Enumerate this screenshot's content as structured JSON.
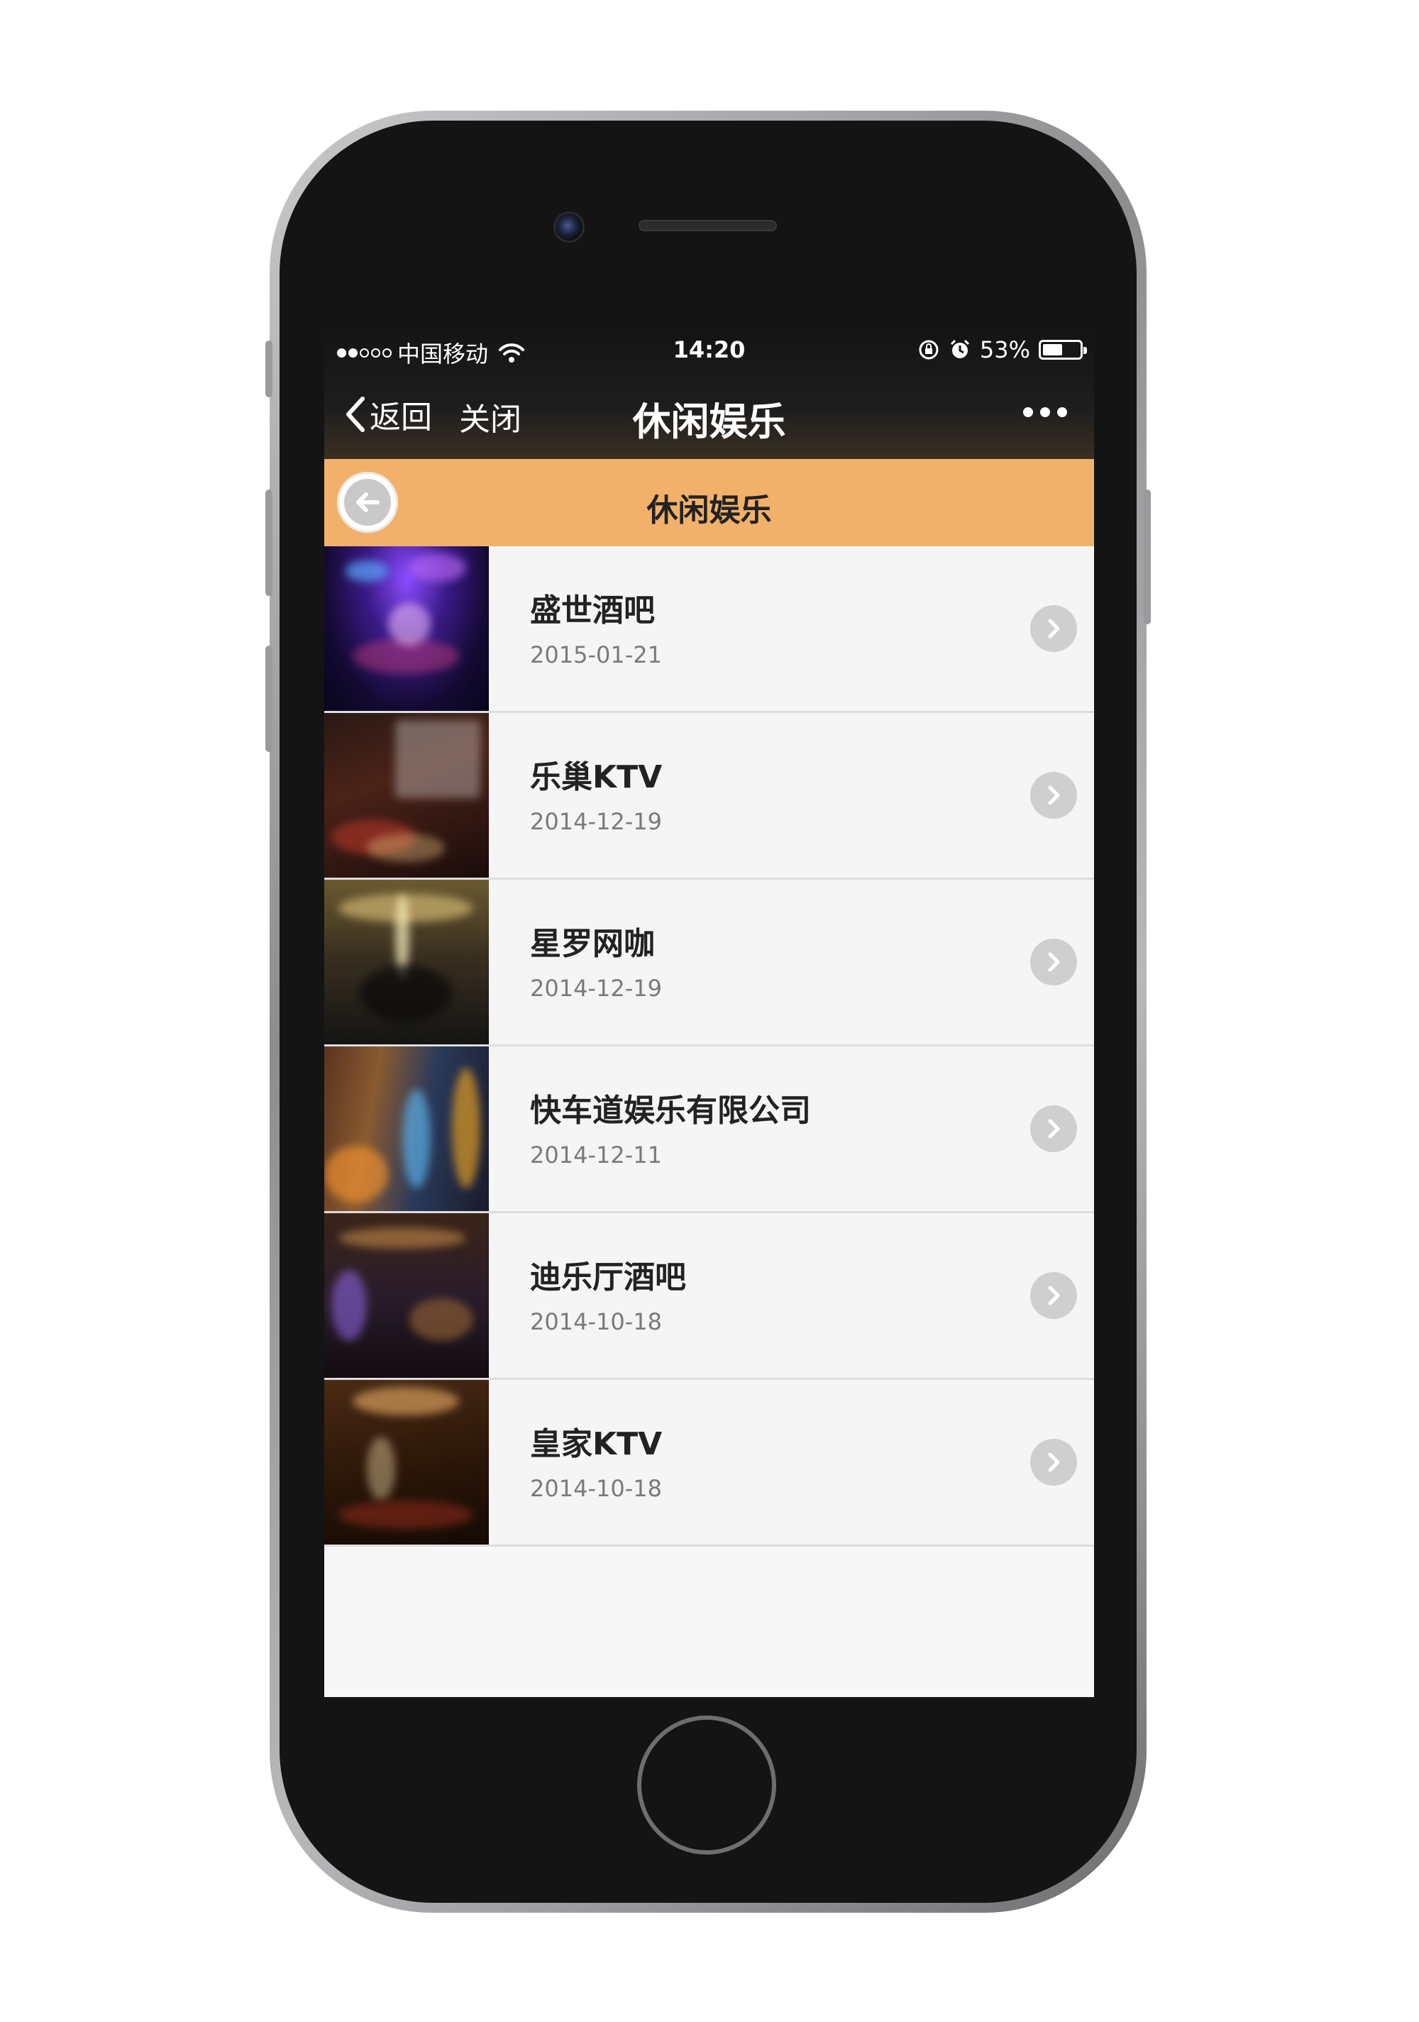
{
  "status_bar": {
    "carrier": "中国移动",
    "time": "14:20",
    "battery_percent": "53%",
    "battery_level": 0.53,
    "icons": [
      "signal-dots",
      "wifi-icon",
      "orientation-lock-icon",
      "alarm-icon",
      "battery-icon"
    ]
  },
  "nav": {
    "back_label": "返回",
    "close_label": "关闭",
    "title": "休闲娱乐",
    "more_icon": "more-dots-icon"
  },
  "page": {
    "title": "休闲娱乐",
    "back_icon": "back-arrow-circle-icon",
    "header_color": "#f2b16a"
  },
  "items": [
    {
      "title": "盛世酒吧",
      "date": "2015-01-21",
      "thumbnail": "bar-interior-photo"
    },
    {
      "title": "乐巢KTV",
      "date": "2014-12-19",
      "thumbnail": "ktv-room-photo"
    },
    {
      "title": "星罗网咖",
      "date": "2014-12-19",
      "thumbnail": "internet-cafe-photo"
    },
    {
      "title": "快车道娱乐有限公司",
      "date": "2014-12-11",
      "thumbnail": "entertainment-hall-photo"
    },
    {
      "title": "迪乐厅酒吧",
      "date": "2014-10-18",
      "thumbnail": "disco-bar-photo"
    },
    {
      "title": "皇家KTV",
      "date": "2014-10-18",
      "thumbnail": "royal-ktv-photo"
    }
  ]
}
